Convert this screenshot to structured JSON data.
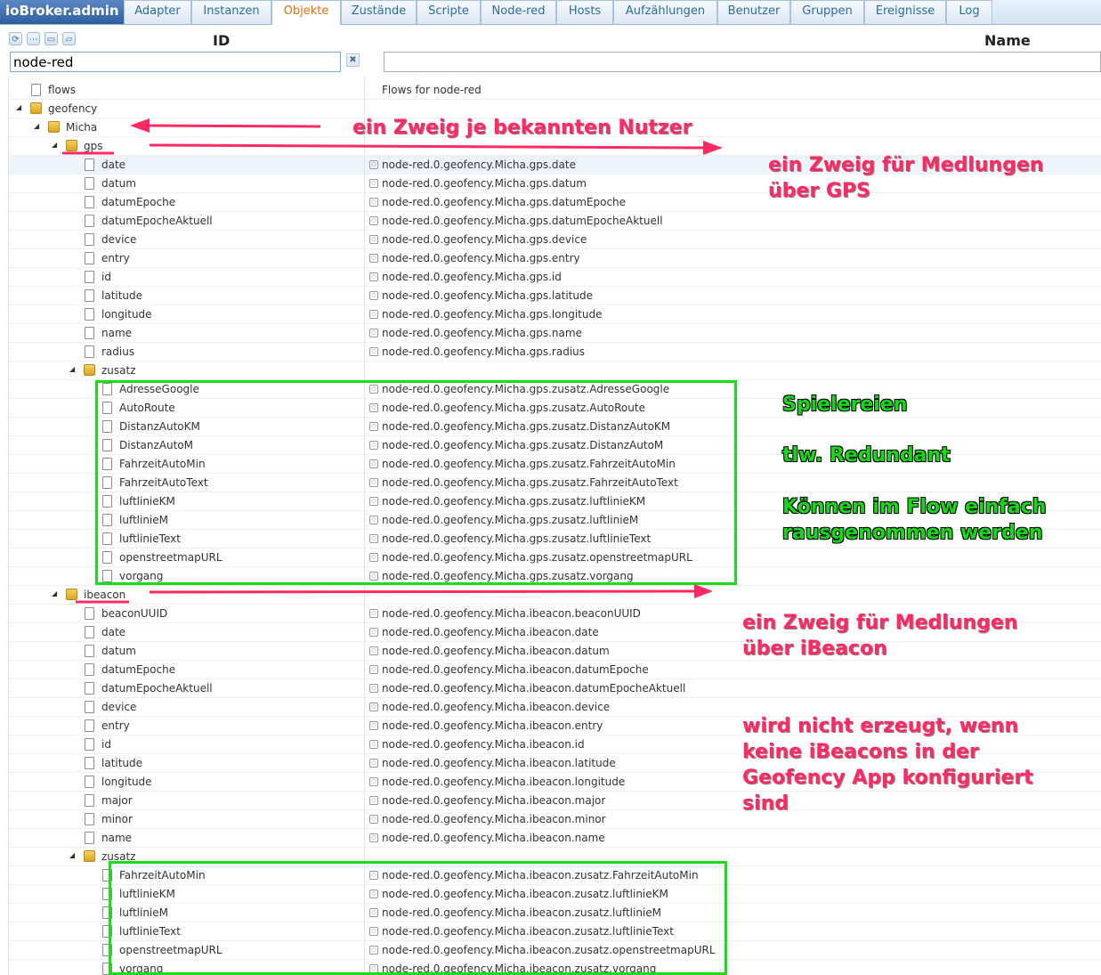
{
  "app": {
    "title": "ioBroker.admin"
  },
  "tabs": [
    {
      "label": "Adapter",
      "active": false
    },
    {
      "label": "Instanzen",
      "active": false
    },
    {
      "label": "Objekte",
      "active": true
    },
    {
      "label": "Zustände",
      "active": false
    },
    {
      "label": "Scripte",
      "active": false
    },
    {
      "label": "Node-red",
      "active": false
    },
    {
      "label": "Hosts",
      "active": false
    },
    {
      "label": "Aufzählungen",
      "active": false
    },
    {
      "label": "Benutzer",
      "active": false
    },
    {
      "label": "Gruppen",
      "active": false
    },
    {
      "label": "Ereignisse",
      "active": false
    },
    {
      "label": "Log",
      "active": false
    }
  ],
  "columns": {
    "id": "ID",
    "name": "Name"
  },
  "toolbar_icons": [
    "refresh-icon",
    "list-icon",
    "folder-open-icon",
    "folder-icon"
  ],
  "filter": {
    "id_value": "node-red",
    "name_value": "",
    "clear_label": "✖"
  },
  "rows": [
    {
      "indent": 1,
      "type": "file",
      "label": "flows",
      "name": "Flows for node-red"
    },
    {
      "indent": 1,
      "type": "folder",
      "label": "geofency",
      "name": ""
    },
    {
      "indent": 2,
      "type": "folder",
      "label": "Micha",
      "name": ""
    },
    {
      "indent": 3,
      "type": "folder",
      "label": "gps",
      "name": ""
    },
    {
      "indent": 4,
      "type": "file",
      "label": "date",
      "name": "node-red.0.geofency.Micha.gps.date",
      "selected": true
    },
    {
      "indent": 4,
      "type": "file",
      "label": "datum",
      "name": "node-red.0.geofency.Micha.gps.datum"
    },
    {
      "indent": 4,
      "type": "file",
      "label": "datumEpoche",
      "name": "node-red.0.geofency.Micha.gps.datumEpoche"
    },
    {
      "indent": 4,
      "type": "file",
      "label": "datumEpocheAktuell",
      "name": "node-red.0.geofency.Micha.gps.datumEpocheAktuell"
    },
    {
      "indent": 4,
      "type": "file",
      "label": "device",
      "name": "node-red.0.geofency.Micha.gps.device"
    },
    {
      "indent": 4,
      "type": "file",
      "label": "entry",
      "name": "node-red.0.geofency.Micha.gps.entry"
    },
    {
      "indent": 4,
      "type": "file",
      "label": "id",
      "name": "node-red.0.geofency.Micha.gps.id"
    },
    {
      "indent": 4,
      "type": "file",
      "label": "latitude",
      "name": "node-red.0.geofency.Micha.gps.latitude"
    },
    {
      "indent": 4,
      "type": "file",
      "label": "longitude",
      "name": "node-red.0.geofency.Micha.gps.longitude"
    },
    {
      "indent": 4,
      "type": "file",
      "label": "name",
      "name": "node-red.0.geofency.Micha.gps.name"
    },
    {
      "indent": 4,
      "type": "file",
      "label": "radius",
      "name": "node-red.0.geofency.Micha.gps.radius"
    },
    {
      "indent": 4,
      "type": "folder",
      "label": "zusatz",
      "name": ""
    },
    {
      "indent": 5,
      "type": "file",
      "label": "AdresseGoogle",
      "name": "node-red.0.geofency.Micha.gps.zusatz.AdresseGoogle"
    },
    {
      "indent": 5,
      "type": "file",
      "label": "AutoRoute",
      "name": "node-red.0.geofency.Micha.gps.zusatz.AutoRoute"
    },
    {
      "indent": 5,
      "type": "file",
      "label": "DistanzAutoKM",
      "name": "node-red.0.geofency.Micha.gps.zusatz.DistanzAutoKM"
    },
    {
      "indent": 5,
      "type": "file",
      "label": "DistanzAutoM",
      "name": "node-red.0.geofency.Micha.gps.zusatz.DistanzAutoM"
    },
    {
      "indent": 5,
      "type": "file",
      "label": "FahrzeitAutoMin",
      "name": "node-red.0.geofency.Micha.gps.zusatz.FahrzeitAutoMin"
    },
    {
      "indent": 5,
      "type": "file",
      "label": "FahrzeitAutoText",
      "name": "node-red.0.geofency.Micha.gps.zusatz.FahrzeitAutoText"
    },
    {
      "indent": 5,
      "type": "file",
      "label": "luftlinieKM",
      "name": "node-red.0.geofency.Micha.gps.zusatz.luftlinieKM"
    },
    {
      "indent": 5,
      "type": "file",
      "label": "luftlinieM",
      "name": "node-red.0.geofency.Micha.gps.zusatz.luftlinieM"
    },
    {
      "indent": 5,
      "type": "file",
      "label": "luftlinieText",
      "name": "node-red.0.geofency.Micha.gps.zusatz.luftlinieText"
    },
    {
      "indent": 5,
      "type": "file",
      "label": "openstreetmapURL",
      "name": "node-red.0.geofency.Micha.gps.zusatz.openstreetmapURL"
    },
    {
      "indent": 5,
      "type": "file",
      "label": "vorgang",
      "name": "node-red.0.geofency.Micha.gps.zusatz.vorgang"
    },
    {
      "indent": 3,
      "type": "folder",
      "label": "ibeacon",
      "name": ""
    },
    {
      "indent": 4,
      "type": "file",
      "label": "beaconUUID",
      "name": "node-red.0.geofency.Micha.ibeacon.beaconUUID"
    },
    {
      "indent": 4,
      "type": "file",
      "label": "date",
      "name": "node-red.0.geofency.Micha.ibeacon.date"
    },
    {
      "indent": 4,
      "type": "file",
      "label": "datum",
      "name": "node-red.0.geofency.Micha.ibeacon.datum"
    },
    {
      "indent": 4,
      "type": "file",
      "label": "datumEpoche",
      "name": "node-red.0.geofency.Micha.ibeacon.datumEpoche"
    },
    {
      "indent": 4,
      "type": "file",
      "label": "datumEpocheAktuell",
      "name": "node-red.0.geofency.Micha.ibeacon.datumEpocheAktuell"
    },
    {
      "indent": 4,
      "type": "file",
      "label": "device",
      "name": "node-red.0.geofency.Micha.ibeacon.device"
    },
    {
      "indent": 4,
      "type": "file",
      "label": "entry",
      "name": "node-red.0.geofency.Micha.ibeacon.entry"
    },
    {
      "indent": 4,
      "type": "file",
      "label": "id",
      "name": "node-red.0.geofency.Micha.ibeacon.id"
    },
    {
      "indent": 4,
      "type": "file",
      "label": "latitude",
      "name": "node-red.0.geofency.Micha.ibeacon.latitude"
    },
    {
      "indent": 4,
      "type": "file",
      "label": "longitude",
      "name": "node-red.0.geofency.Micha.ibeacon.longitude"
    },
    {
      "indent": 4,
      "type": "file",
      "label": "major",
      "name": "node-red.0.geofency.Micha.ibeacon.major"
    },
    {
      "indent": 4,
      "type": "file",
      "label": "minor",
      "name": "node-red.0.geofency.Micha.ibeacon.minor"
    },
    {
      "indent": 4,
      "type": "file",
      "label": "name",
      "name": "node-red.0.geofency.Micha.ibeacon.name"
    },
    {
      "indent": 4,
      "type": "folder",
      "label": "zusatz",
      "name": ""
    },
    {
      "indent": 5,
      "type": "file",
      "label": "FahrzeitAutoMin",
      "name": "node-red.0.geofency.Micha.ibeacon.zusatz.FahrzeitAutoMin"
    },
    {
      "indent": 5,
      "type": "file",
      "label": "luftlinieKM",
      "name": "node-red.0.geofency.Micha.ibeacon.zusatz.luftlinieKM"
    },
    {
      "indent": 5,
      "type": "file",
      "label": "luftlinieM",
      "name": "node-red.0.geofency.Micha.ibeacon.zusatz.luftlinieM"
    },
    {
      "indent": 5,
      "type": "file",
      "label": "luftlinieText",
      "name": "node-red.0.geofency.Micha.ibeacon.zusatz.luftlinieText"
    },
    {
      "indent": 5,
      "type": "file",
      "label": "openstreetmapURL",
      "name": "node-red.0.geofency.Micha.ibeacon.zusatz.openstreetmapURL"
    },
    {
      "indent": 5,
      "type": "file",
      "label": "vorgang",
      "name": "node-red.0.geofency.Micha.ibeacon.zusatz.vorgang"
    }
  ],
  "annotations": {
    "user_branch": "ein Zweig je bekannten Nutzer",
    "gps_line1": "ein Zweig für Medlungen",
    "gps_line2": "über GPS",
    "spielereien": "Spielereien",
    "redundant": "tlw. Redundant",
    "flow_line1": "Können im Flow einfach",
    "flow_line2": "rausgenommen werden",
    "ibeacon_line1": "ein Zweig für Medlungen",
    "ibeacon_line2": "über iBeacon",
    "notcreated_line1": "wird nicht erzeugt, wenn",
    "notcreated_line2": "keine iBeacons in der",
    "notcreated_line3": "Geofency App konfiguriert",
    "notcreated_line4": "sind"
  },
  "colors": {
    "annotation_red": "#ff2a63",
    "annotation_green": "#16d916",
    "active_tab": "#e17009",
    "tab_text": "#2e6e9e"
  }
}
